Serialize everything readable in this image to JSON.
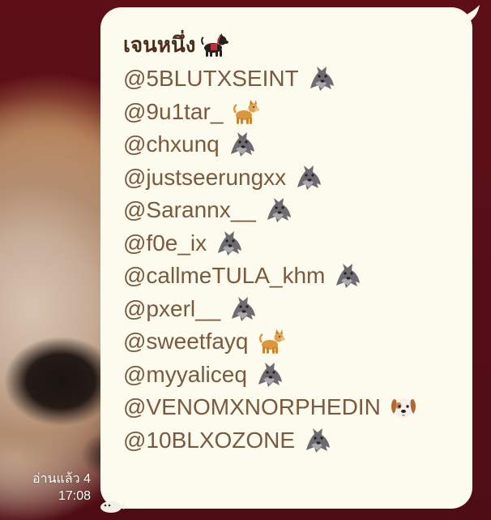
{
  "message": {
    "title": "เจนหนึ่ง",
    "title_icon": "dog-with-harness-icon",
    "mentions": [
      {
        "handle": "@5BLUTXSEINT",
        "icon": "wolf-icon"
      },
      {
        "handle": "@9u1tar_",
        "icon": "dog-icon"
      },
      {
        "handle": "@chxunq",
        "icon": "wolf-icon"
      },
      {
        "handle": "@justseerungxx",
        "icon": "wolf-icon"
      },
      {
        "handle": "@Sarannx__",
        "icon": "wolf-icon"
      },
      {
        "handle": "@f0e_ix",
        "icon": "wolf-icon"
      },
      {
        "handle": "@callmeTULA_khm",
        "icon": "wolf-icon"
      },
      {
        "handle": "@pxerl__",
        "icon": "wolf-icon"
      },
      {
        "handle": "@sweetfayq",
        "icon": "dog-icon"
      },
      {
        "handle": "@myyaliceq",
        "icon": "wolf-icon"
      },
      {
        "handle": "@VENOMXNORPHEDIN",
        "icon": "dog-face-icon"
      },
      {
        "handle": "@10BLXOZONE",
        "icon": "wolf-icon"
      }
    ]
  },
  "meta": {
    "read_status": "อ่านแล้ว 4",
    "time": "17:08"
  },
  "colors": {
    "bubble": "#fdfbee",
    "text": "#7a5a3f",
    "background": "#5a0f17"
  }
}
